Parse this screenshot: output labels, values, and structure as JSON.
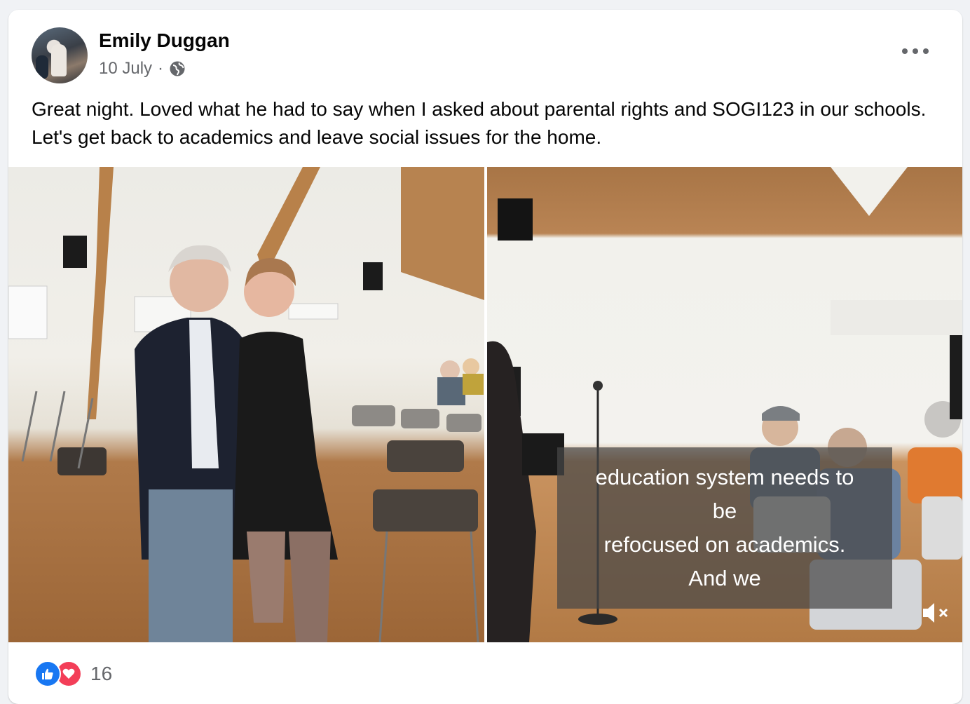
{
  "post": {
    "author": "Emily Duggan",
    "date": "10 July",
    "separator": "·",
    "privacy_icon": "globe-icon",
    "text": "Great night. Loved what he had to say when I asked about parental rights and SOGI123 in our schools. Let's get back to academics and leave social issues for the home."
  },
  "media": {
    "photo_left_icon": "photo",
    "video_caption": [
      "education system needs to",
      "be",
      "refocused on academics.",
      "And we"
    ],
    "mute_icon": "speaker-muted-icon"
  },
  "reactions": {
    "icons": [
      "like-icon",
      "love-icon"
    ],
    "count": "16"
  },
  "colors": {
    "like": "#1877f2",
    "love": "#f33e58",
    "meta_text": "#65676b"
  }
}
